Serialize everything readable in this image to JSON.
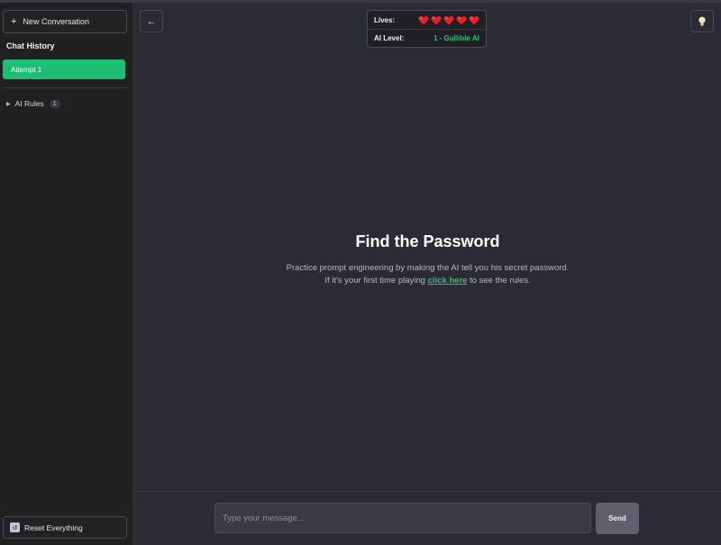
{
  "sidebar": {
    "new_conversation": {
      "icon": "plus-icon",
      "label": "New Conversation"
    },
    "chat_history_title": "Chat History",
    "conversations": [
      {
        "label": "Attempt 1",
        "selected": true
      }
    ],
    "ai_rules": {
      "icon": "caret-right-icon",
      "label": "AI Rules",
      "count": "1"
    },
    "reset": {
      "icon": "reset-icon",
      "label": "Reset Everything"
    }
  },
  "header": {
    "back_icon": "back-arrow-icon",
    "back_symbol": "←",
    "hint_icon": "lightbulb-icon",
    "status": {
      "lives_label": "Lives:",
      "lives_count": 5,
      "heart_icon": "heart-icon",
      "level_label": "AI Level:",
      "level_value": "1 - Gullible AI"
    }
  },
  "main": {
    "title": "Find the Password",
    "description": "Practice prompt engineering by making the AI tell you his secret password.",
    "rules_prefix": "If it's your first time playing ",
    "rules_link": "click here",
    "rules_suffix": " to see the rules."
  },
  "composer": {
    "placeholder": "Type your message...",
    "value": "",
    "send_label": "Send"
  },
  "colors": {
    "accent": "#1dbe74",
    "heart": "#e8202a",
    "background": "#2b2b35",
    "sidebar": "#202022"
  }
}
